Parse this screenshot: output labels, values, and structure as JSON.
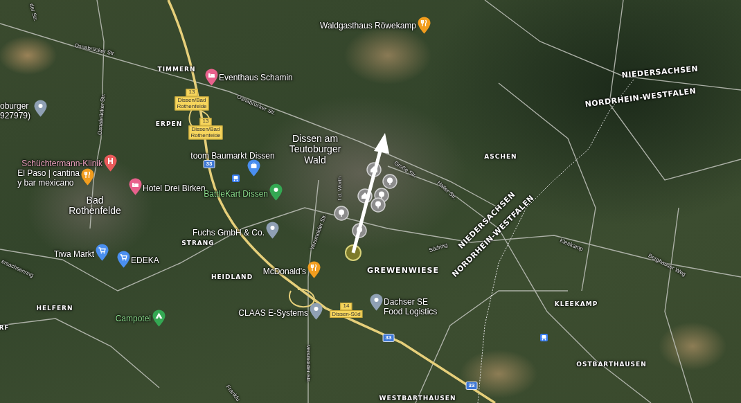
{
  "map": {
    "labels": [
      {
        "kind": "place",
        "text": "TIMMERN"
      },
      {
        "kind": "place",
        "text": "ERPEN"
      },
      {
        "kind": "place",
        "text": "ASCHEN"
      },
      {
        "kind": "place",
        "text": "STRANG"
      },
      {
        "kind": "place",
        "text": "HEIDLAND"
      },
      {
        "kind": "place",
        "text": "HELFERN"
      },
      {
        "kind": "place",
        "text": "GREWENWIESE"
      },
      {
        "kind": "place",
        "text": "KLEEKAMP"
      },
      {
        "kind": "place",
        "text": "OSTBARTHAUSEN"
      },
      {
        "kind": "place",
        "text": "WESTBARTHAUSEN"
      },
      {
        "kind": "place",
        "text": "RF"
      },
      {
        "kind": "town",
        "text": "Dissen am\nTeutoburger\nWald"
      },
      {
        "kind": "town",
        "text": "Bad\nRothenfelde"
      },
      {
        "kind": "poi",
        "text": "Eventhaus Schamin",
        "color": "#e8618c"
      },
      {
        "kind": "poi",
        "text": "Waldgasthaus Röwekamp",
        "color": "#f29d1e"
      },
      {
        "kind": "poi",
        "text": "oburger\n927979)",
        "color": "#8fa0b4"
      },
      {
        "kind": "poi",
        "text": "Schüchtermann-Klinik",
        "color": "#ea5b5b"
      },
      {
        "kind": "poi",
        "text": "El Paso | cantina\ny bar mexicano",
        "color": "#f29d1e"
      },
      {
        "kind": "poi",
        "text": "Hotel Drei Birken",
        "color": "#e8618c"
      },
      {
        "kind": "poi",
        "text": "toom Baumarkt Dissen",
        "color": "#4a8ff0"
      },
      {
        "kind": "poi",
        "text": "BattleKart Dissen",
        "color": "#34a853"
      },
      {
        "kind": "poi",
        "text": "Fuchs GmbH & Co.",
        "color": "#8fa0b4"
      },
      {
        "kind": "poi",
        "text": "Tiwa Markt",
        "color": "#4a8ff0"
      },
      {
        "kind": "poi",
        "text": "EDEKA",
        "color": "#4a8ff0"
      },
      {
        "kind": "poi",
        "text": "Campotel",
        "color": "#34a853"
      },
      {
        "kind": "poi",
        "text": "McDonald's",
        "color": "#f29d1e"
      },
      {
        "kind": "poi",
        "text": "CLAAS E-Systems",
        "color": "#8fa0b4"
      },
      {
        "kind": "poi",
        "text": "Dachser SE\nFood Logistics",
        "color": "#8fa0b4"
      },
      {
        "kind": "road",
        "text": "Osnabrücker Str."
      },
      {
        "kind": "road",
        "text": "Osnabrücker Str."
      },
      {
        "kind": "road",
        "text": "Osnabrücker Str."
      },
      {
        "kind": "road",
        "text": "der Str."
      },
      {
        "kind": "road",
        "text": "Große Str."
      },
      {
        "kind": "road",
        "text": "Haller Str."
      },
      {
        "kind": "road",
        "text": "f d. Worth"
      },
      {
        "kind": "road",
        "text": "Versmolder Str."
      },
      {
        "kind": "road",
        "text": "Versmolder Str."
      },
      {
        "kind": "road",
        "text": "Südring"
      },
      {
        "kind": "road",
        "text": "Kleekamp"
      },
      {
        "kind": "road",
        "text": "Berghauser Weg"
      },
      {
        "kind": "road",
        "text": "Frankfu"
      },
      {
        "kind": "road",
        "text": "ersachsenring"
      },
      {
        "kind": "border",
        "text": "NIEDERSACHSEN"
      },
      {
        "kind": "border",
        "text": "NORDRHEIN-WESTFALEN"
      },
      {
        "kind": "border",
        "text": "NIEDERSACHSEN"
      },
      {
        "kind": "border",
        "text": "NORDRHEIN-WESTFALEN"
      },
      {
        "kind": "exit",
        "number": "13",
        "text": "Dissen/Bad\nRothenfelde"
      },
      {
        "kind": "exit",
        "number": "13",
        "text": "Dissen/Bad\nRothenfelde"
      },
      {
        "kind": "exit",
        "number": "14",
        "text": "Dissen-Süd"
      },
      {
        "kind": "shield",
        "text": "33"
      },
      {
        "kind": "shield",
        "text": "33"
      },
      {
        "kind": "shield",
        "text": "33"
      }
    ]
  }
}
